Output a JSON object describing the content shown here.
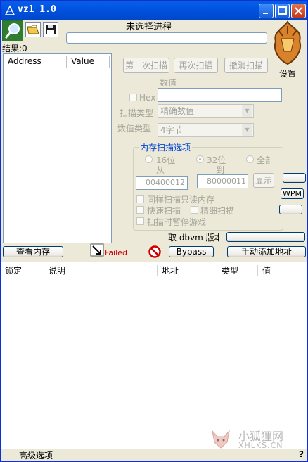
{
  "window": {
    "title": "vz1 1.0"
  },
  "process": {
    "title": "未选择进程"
  },
  "toolbar": {
    "settings_label": "设置"
  },
  "results": {
    "label": "结果:0"
  },
  "address_list": {
    "col_address": "Address",
    "col_value": "Value"
  },
  "scan": {
    "first_scan": "第一次扫描",
    "next_scan": "再次扫描",
    "undo_scan": "撤消扫描",
    "value_label": "数值",
    "hex_label": "Hex",
    "scan_type_label": "扫描类型",
    "scan_type_value": "精确数值",
    "value_type_label": "数值类型",
    "value_type_value": "4字节"
  },
  "memory_options": {
    "title": "内存扫描选项",
    "bit16": "16位",
    "bit32": "32位",
    "all": "全部",
    "from_label": "从",
    "to_label": "到",
    "from_value": "00400012",
    "to_value": "80000011",
    "show_button": "显示",
    "same_readonly": "同样扫描只读内存",
    "fast_scan": "快速扫描",
    "precise_scan": "精细扫描",
    "pause_game": "扫描时暂停游戏"
  },
  "side": {
    "wpm_button": "WPM"
  },
  "dbvm": {
    "label": "取 dbvm 版本"
  },
  "actions": {
    "view_memory": "查看内存",
    "failed_text": "Failed",
    "bypass": "Bypass",
    "add_address": "手动添加地址"
  },
  "table": {
    "columns": [
      "锁定",
      "说明",
      "地址",
      "类型",
      "值"
    ]
  },
  "statusbar": {
    "advanced": "高级选项",
    "help": "?"
  },
  "watermark": {
    "cn": "小狐狸网",
    "en": "XHLKS.CN"
  },
  "colors": {
    "titlebar": "#0054e3",
    "group_title": "#0046d5",
    "failed": "#cc0000"
  }
}
